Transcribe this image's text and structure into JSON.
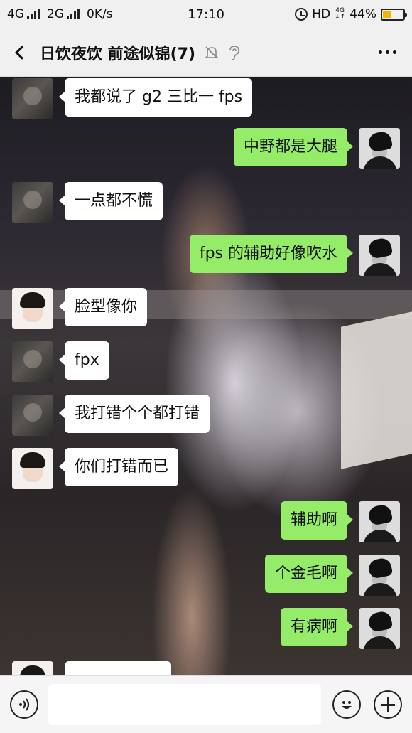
{
  "status_bar": {
    "network1": "4G",
    "network2": "2G",
    "speed": "0K/s",
    "time": "17:10",
    "hd": "HD",
    "net_small_top": "4G",
    "net_small_bottom": "↓↑",
    "battery_percent": "44%",
    "battery_level": 0.44
  },
  "header": {
    "title": "日饮夜饮 前途似锦(7)",
    "mute_icon": "bell-off-icon",
    "ear_icon": "ear-icon",
    "more_icon": "more-dots-icon"
  },
  "messages": [
    {
      "side": "left",
      "avatar": "dark",
      "text": "我都说了 g2 三比一 fps"
    },
    {
      "side": "right",
      "avatar": "bw",
      "text": "中野都是大腿"
    },
    {
      "side": "left",
      "avatar": "dark",
      "text": "一点都不慌"
    },
    {
      "side": "right",
      "avatar": "bw",
      "text": "fps 的辅助好像吹水"
    },
    {
      "side": "left",
      "avatar": "boy",
      "text": "脸型像你"
    },
    {
      "side": "left",
      "avatar": "dark",
      "text": "fpx"
    },
    {
      "side": "left",
      "avatar": "dark",
      "text": "我打错个个都打错"
    },
    {
      "side": "left",
      "avatar": "boy",
      "text": "你们打错而已"
    },
    {
      "side": "right",
      "avatar": "bw",
      "text": "辅助啊"
    },
    {
      "side": "right",
      "avatar": "bw",
      "text": "个金毛啊"
    },
    {
      "side": "right",
      "avatar": "bw",
      "text": "有病啊"
    },
    {
      "side": "left",
      "avatar": "boy",
      "text": ""
    }
  ],
  "input_bar": {
    "voice_icon": "voice-icon",
    "emoji_icon": "emoji-icon",
    "plus_icon": "plus-icon",
    "input_value": ""
  },
  "colors": {
    "sent_bubble": "#95ec69",
    "received_bubble": "#ffffff",
    "battery": "#f2b400"
  }
}
